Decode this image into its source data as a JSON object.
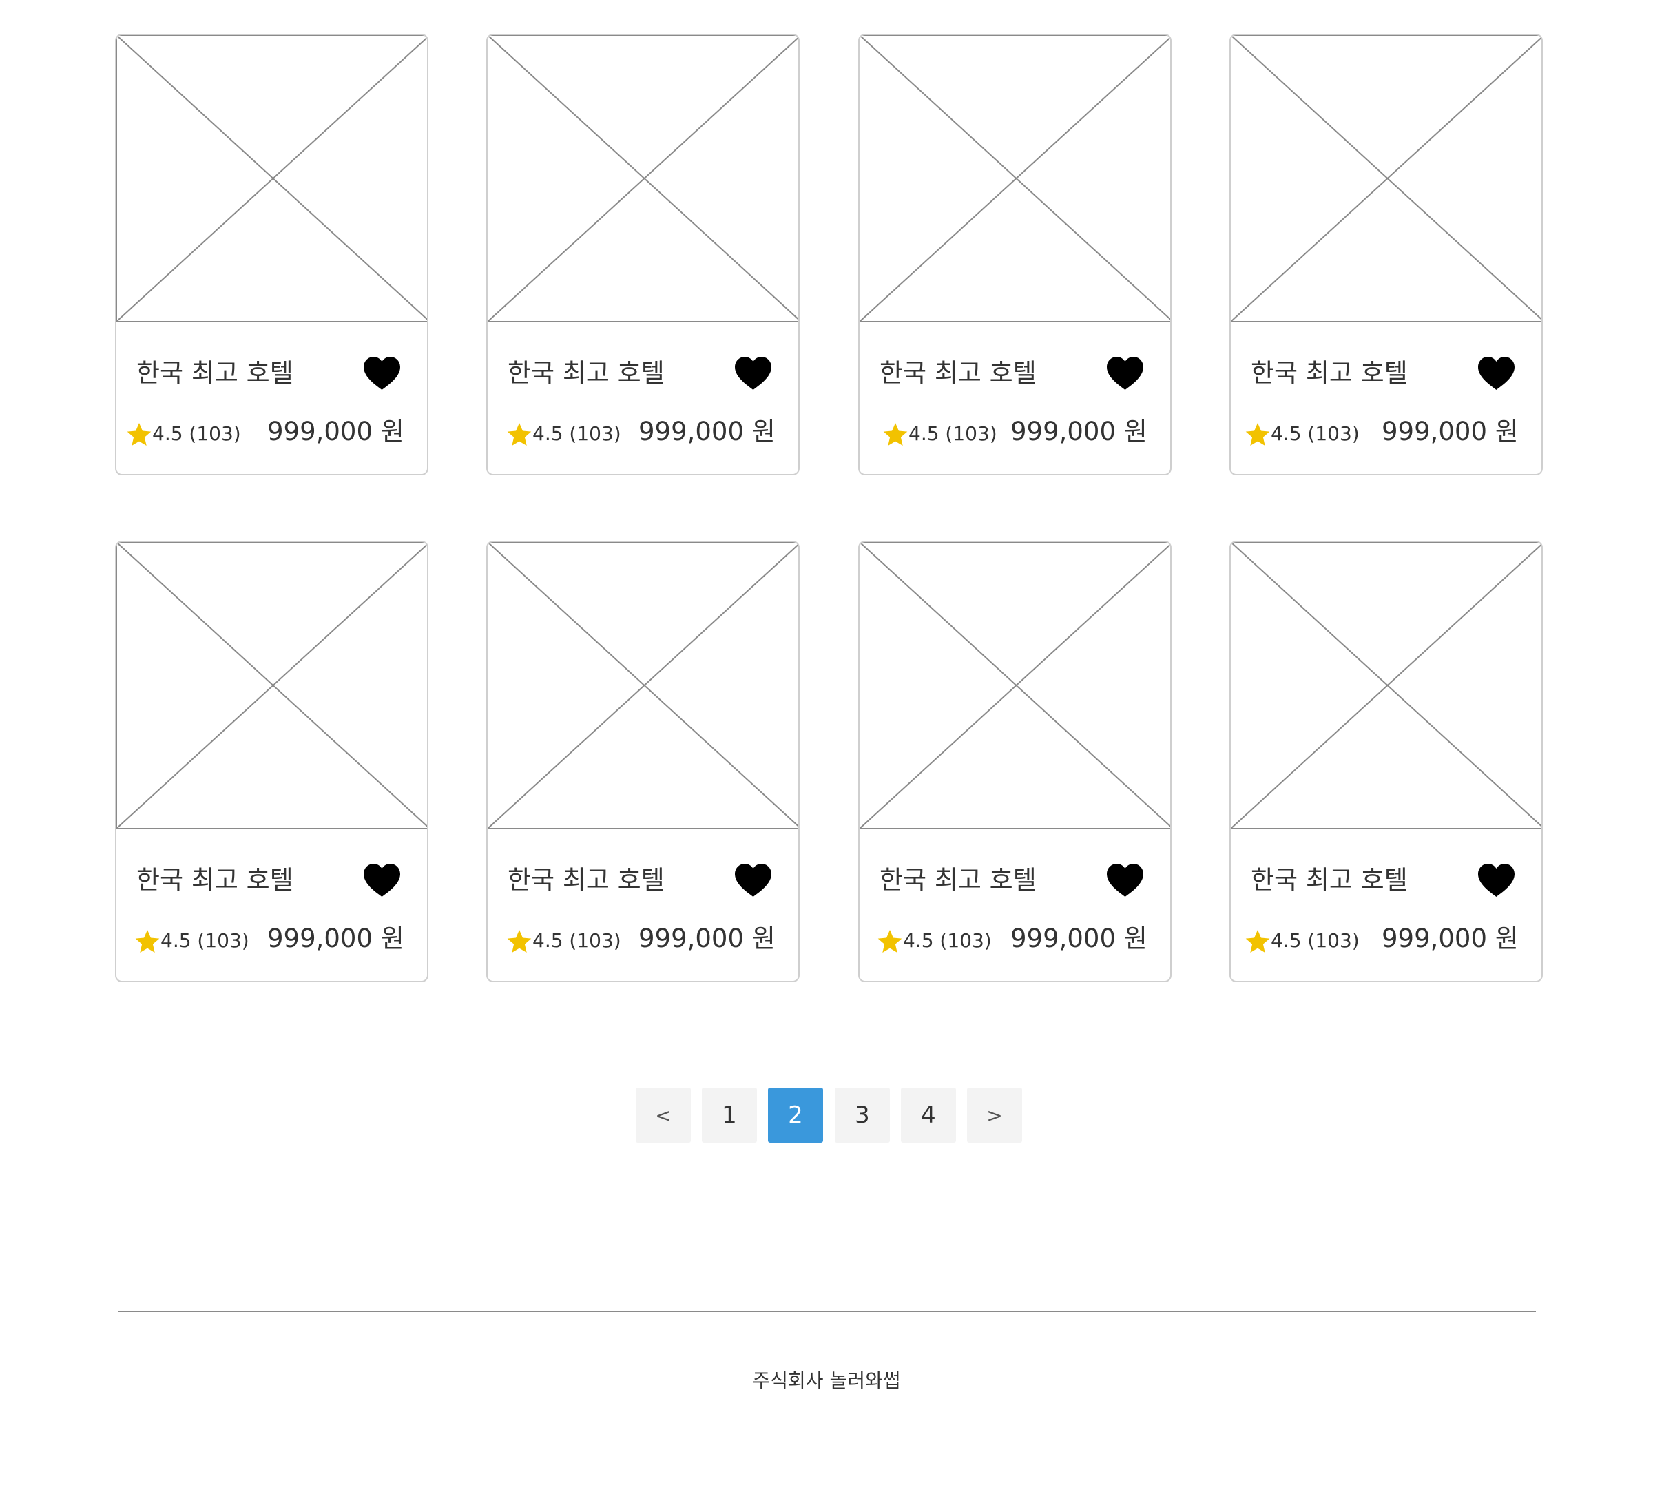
{
  "listing": {
    "cards": [
      {
        "title": "한국 최고 호텔",
        "rating": "4.5 (103)",
        "price": "999,000 원"
      },
      {
        "title": "한국 최고 호텔",
        "rating": "4.5 (103)",
        "price": "999,000 원"
      },
      {
        "title": "한국 최고 호텔",
        "rating": "4.5 (103)",
        "price": "999,000 원"
      },
      {
        "title": "한국 최고 호텔",
        "rating": "4.5 (103)",
        "price": "999,000 원"
      },
      {
        "title": "한국 최고 호텔",
        "rating": "4.5 (103)",
        "price": "999,000 원"
      },
      {
        "title": "한국 최고 호텔",
        "rating": "4.5 (103)",
        "price": "999,000 원"
      },
      {
        "title": "한국 최고 호텔",
        "rating": "4.5 (103)",
        "price": "999,000 원"
      },
      {
        "title": "한국 최고 호텔",
        "rating": "4.5 (103)",
        "price": "999,000 원"
      }
    ],
    "icons": {
      "thumbnail": "image-placeholder-icon",
      "favorite": "heart-icon",
      "rating": "star-icon"
    },
    "colors": {
      "star": "#f2c200",
      "heart": "#000000",
      "card_border": "#cfcfcf",
      "placeholder_line": "#8a8a8a"
    }
  },
  "pagination": {
    "prev_label": "<",
    "next_label": ">",
    "pages": [
      "1",
      "2",
      "3",
      "4"
    ],
    "current_page": "2",
    "active_color": "#3a98dc"
  },
  "footer": {
    "company": "주식회사 놀러와썹"
  }
}
